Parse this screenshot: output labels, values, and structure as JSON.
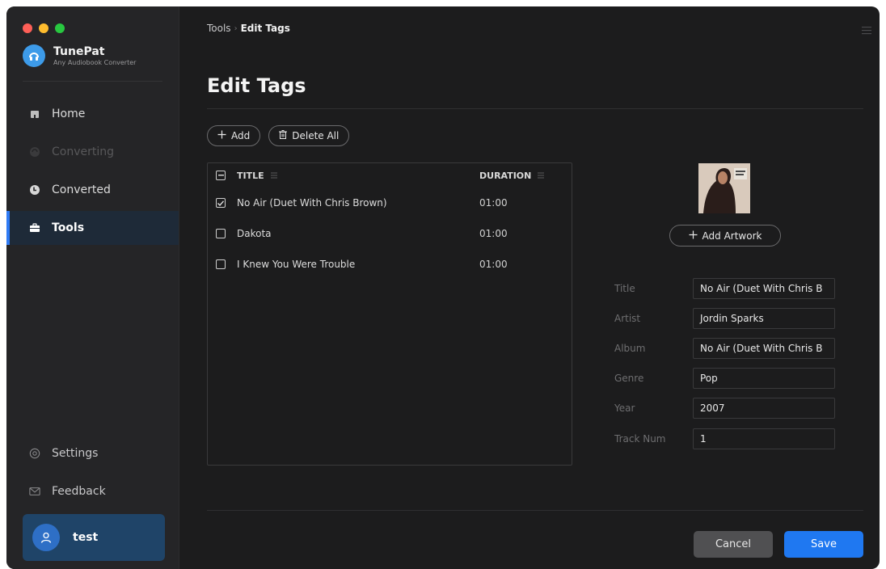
{
  "app": {
    "name": "TunePat",
    "subtitle": "Any Audiobook Converter"
  },
  "sidebar": {
    "items": [
      {
        "label": "Home",
        "icon": "home-icon",
        "state": "normal"
      },
      {
        "label": "Converting",
        "icon": "converting-icon",
        "state": "disabled"
      },
      {
        "label": "Converted",
        "icon": "clock-icon",
        "state": "normal"
      },
      {
        "label": "Tools",
        "icon": "toolbox-icon",
        "state": "active"
      }
    ],
    "bottom_items": [
      {
        "label": "Settings",
        "icon": "gear-icon"
      },
      {
        "label": "Feedback",
        "icon": "mail-icon"
      }
    ],
    "user": {
      "name": "test"
    }
  },
  "breadcrumb": {
    "parent": "Tools",
    "separator": "›",
    "current": "Edit Tags"
  },
  "page": {
    "title": "Edit Tags"
  },
  "toolbar": {
    "add_label": "Add",
    "delete_all_label": "Delete All"
  },
  "list": {
    "columns": {
      "title": "TITLE",
      "duration": "DURATION"
    },
    "rows": [
      {
        "title": "No Air (Duet With Chris Brown)",
        "duration": "01:00",
        "checked": true
      },
      {
        "title": "Dakota",
        "duration": "01:00",
        "checked": false
      },
      {
        "title": "I Knew You Were Trouble",
        "duration": "01:00",
        "checked": false
      }
    ]
  },
  "artwork": {
    "add_label": "Add Artwork"
  },
  "fields": [
    {
      "label": "Title",
      "value": "No Air (Duet With Chris B"
    },
    {
      "label": "Artist",
      "value": "Jordin Sparks"
    },
    {
      "label": "Album",
      "value": "No Air (Duet With Chris B"
    },
    {
      "label": "Genre",
      "value": "Pop"
    },
    {
      "label": "Year",
      "value": "2007"
    },
    {
      "label": "Track Num",
      "value": "1"
    }
  ],
  "actions": {
    "cancel_label": "Cancel",
    "save_label": "Save"
  },
  "colors": {
    "accent": "#1f78f1",
    "sidebar_bg": "#252527",
    "main_bg": "#1c1c1d"
  }
}
